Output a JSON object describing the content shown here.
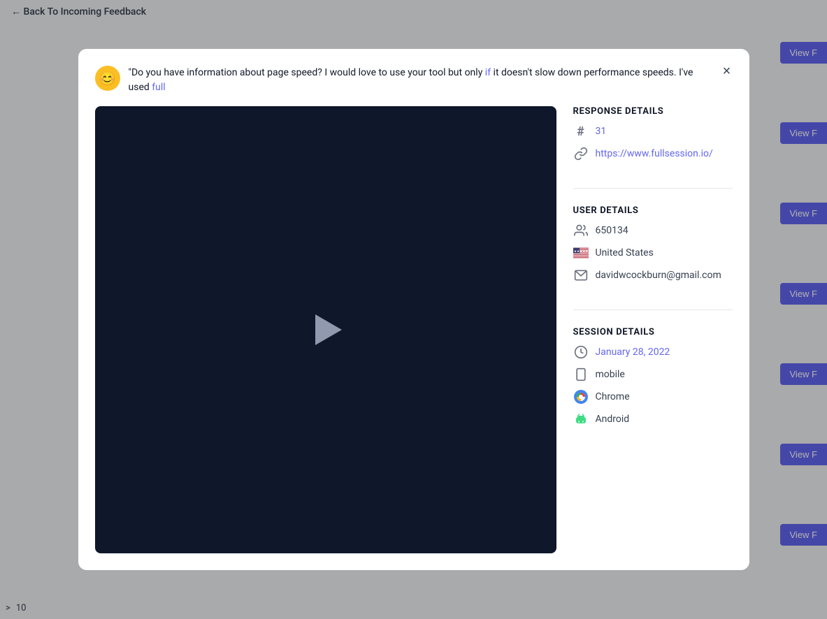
{
  "page": {
    "header": "← Back To Incoming Feedback",
    "pagination": {
      "arrow": ">",
      "number": "10"
    }
  },
  "viewButtons": [
    "View F",
    "View F",
    "View F",
    "View F",
    "View F",
    "View F",
    "View F"
  ],
  "modal": {
    "close_label": "×",
    "feedback_text": "\"Do you have information about page speed? I would love to use your tool but only if it doesn't slow down performance speeds. I've used full",
    "feedback_highlight_words": [
      "if",
      "full"
    ],
    "response_details": {
      "section_title": "RESPONSE DETAILS",
      "id_number": "31",
      "url": "https://www.fullsession.io/"
    },
    "user_details": {
      "section_title": "USER DETAILS",
      "user_id": "650134",
      "country": "United States",
      "email": "davidwcockburn@gmail.com"
    },
    "session_details": {
      "section_title": "SESSION DETAILS",
      "date": "January 28, 2022",
      "device": "mobile",
      "browser": "Chrome",
      "os": "Android"
    }
  }
}
